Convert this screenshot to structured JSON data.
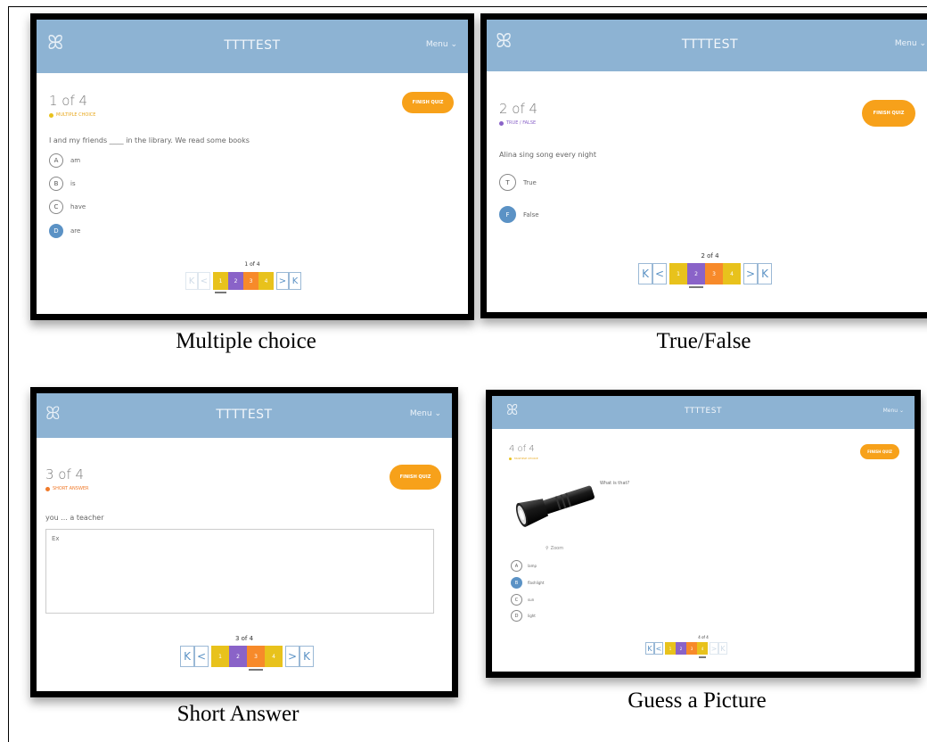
{
  "app_title": "TTTTEST",
  "menu_label": "Menu ⌄",
  "logo_glyph": "ꕤ",
  "finish_label": "FINISH QUIZ",
  "nav": {
    "first": "K",
    "prev": "<",
    "next": ">",
    "last": "K"
  },
  "page_numbers": [
    "1",
    "2",
    "3",
    "4"
  ],
  "colors": {
    "topbar": "#8db3d3",
    "finish": "#f7a11a",
    "page1": "#e8c21c",
    "page2": "#8a63c8",
    "page3": "#f78a2a",
    "page4": "#e8c21c",
    "selected_option": "#5b92c5"
  },
  "panels": {
    "mc": {
      "counter": "1 of 4",
      "type_label": "MULTIPLE CHOICE",
      "type_color": "#e8a81c",
      "question": "I and my friends ____ in the library. We read some books",
      "options": [
        {
          "letter": "A",
          "text": "am",
          "selected": false
        },
        {
          "letter": "B",
          "text": "is",
          "selected": false
        },
        {
          "letter": "C",
          "text": "have",
          "selected": false
        },
        {
          "letter": "D",
          "text": "are",
          "selected": true
        }
      ],
      "pager_label": "1 of 4",
      "current_page": 1
    },
    "tf": {
      "counter": "2 of 4",
      "type_label": "TRUE / FALSE",
      "type_color": "#8a63c8",
      "question": "Alina sing song every night",
      "options": [
        {
          "letter": "T",
          "text": "True",
          "selected": false
        },
        {
          "letter": "F",
          "text": "False",
          "selected": true
        }
      ],
      "pager_label": "2 of 4",
      "current_page": 2
    },
    "sa": {
      "counter": "3 of 4",
      "type_label": "SHORT ANSWER",
      "type_color": "#f07a2a",
      "question": "you ... a teacher",
      "answer_placeholder": "Ex",
      "pager_label": "3 of 4",
      "current_page": 3
    },
    "gp": {
      "counter": "4 of 4",
      "type_label": "MULTIPLE CHOICE",
      "type_color": "#e8a81c",
      "question": "What is that?",
      "zoom_label": "Zoom",
      "options": [
        {
          "letter": "A",
          "text": "lamp",
          "selected": false
        },
        {
          "letter": "B",
          "text": "flashlight",
          "selected": true
        },
        {
          "letter": "C",
          "text": "sun",
          "selected": false
        },
        {
          "letter": "D",
          "text": "light",
          "selected": false
        }
      ],
      "pager_label": "4 of 4",
      "current_page": 4
    }
  },
  "captions": {
    "mc": "Multiple choice",
    "tf": "True/False",
    "sa": "Short Answer",
    "gp": "Guess a Picture"
  }
}
